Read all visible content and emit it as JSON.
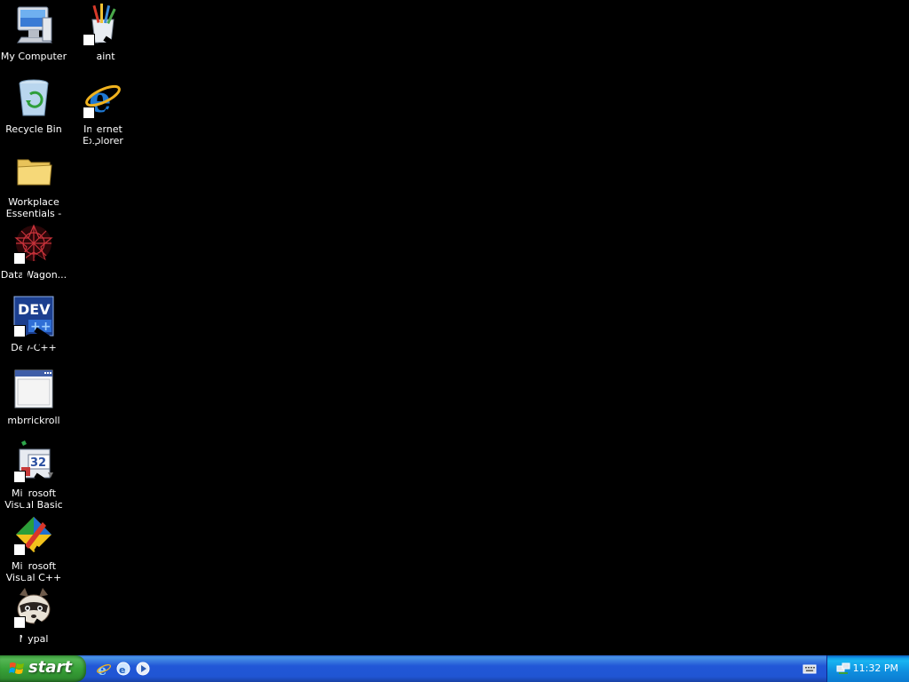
{
  "desktop": {
    "icons": [
      {
        "label": "My Computer",
        "icon": "computer-icon"
      },
      {
        "label": "Paint",
        "icon": "paint-icon",
        "shortcut": true
      },
      {
        "label": "Recycle Bin",
        "icon": "recycle-bin-icon"
      },
      {
        "label": "Internet Explorer",
        "icon": "internet-explorer-icon",
        "shortcut": true
      },
      {
        "label": "Workplace Essentials - J...",
        "icon": "folder-icon"
      },
      {
        "label": "DataWagon...",
        "icon": "datawagon-icon",
        "shortcut": true
      },
      {
        "label": "Dev-C++",
        "icon": "dev-cpp-icon",
        "shortcut": true
      },
      {
        "label": "mbrrickroll",
        "icon": "application-window-icon"
      },
      {
        "label": "Microsoft Visual Basic 6.0",
        "icon": "visual-basic-icon",
        "shortcut": true
      },
      {
        "label": "Microsoft Visual C++ 6.0",
        "icon": "visual-cpp-icon",
        "shortcut": true
      },
      {
        "label": "Mypal",
        "icon": "raccoon-icon",
        "shortcut": true
      }
    ]
  },
  "taskbar": {
    "start_label": "start",
    "quick_launch": [
      "internet-explorer-icon",
      "outlook-express-icon",
      "media-player-icon"
    ],
    "tray": {
      "clock": "11:32 PM",
      "icons": [
        "keyboard-icon",
        "network-icon"
      ]
    }
  },
  "colors": {
    "desktop_background": "#000000",
    "taskbar_blue": "#2157d7",
    "start_green": "#38a238",
    "tray_blue": "#0f8fdf"
  }
}
